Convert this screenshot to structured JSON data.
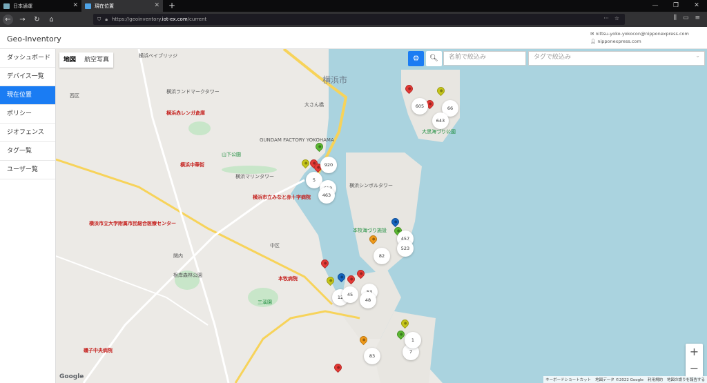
{
  "browser": {
    "tabs": [
      {
        "label": "日本通運",
        "active": false
      },
      {
        "label": "現在位置",
        "active": true
      }
    ],
    "url_prefix": "https://geoinventory.",
    "url_host": "iot-ex.com",
    "url_path": "/current"
  },
  "app": {
    "brand": "Geo-Inventory",
    "user_email": "nittsu-yoko-yokocon@nipponexpress.com",
    "user_org": "nipponexpress.com"
  },
  "sidebar": {
    "items": [
      {
        "label": "ダッシュボード",
        "active": false
      },
      {
        "label": "デバイス一覧",
        "active": false
      },
      {
        "label": "現在位置",
        "active": true
      },
      {
        "label": "ポリシー",
        "active": false
      },
      {
        "label": "ジオフェンス",
        "active": false
      },
      {
        "label": "タグ一覧",
        "active": false
      },
      {
        "label": "ユーザー覧",
        "active": false
      }
    ]
  },
  "map": {
    "maptype": [
      "地図",
      "航空写真"
    ],
    "name_filter_placeholder": "名前で絞込み",
    "tag_filter_placeholder": "タグで絞込み",
    "labels": {
      "yokohama": "横浜市",
      "kannai": "関内",
      "yamashita": "山下公園",
      "osanbashi": "大さん橋",
      "chinatown": "横浜中華街",
      "marine_tower": "横浜マリンタワー",
      "redbrick": "横浜赤レンガ倉庫",
      "landmark": "横浜ランドマークタワー",
      "gundam": "GUNDAM FACTORY YOKOHAMA",
      "honmoku_park": "本牧海づり施設",
      "ohguro": "大黒海づり公園",
      "city_hosp": "横浜市立みなと赤十字病院",
      "univ_hosp": "横浜市立大学附属市民総合医療センター",
      "naka": "中区",
      "honmoku_hosp": "本牧病院",
      "sankei": "三溪園",
      "negishi": "根岸森林公園",
      "isogo": "磯子中央病院",
      "nishi": "西区",
      "bay_bridge": "横浜ベイブリッジ",
      "shell_tower": "横浜シンボルタワー"
    },
    "clusters": [
      "605",
      "66",
      "643",
      "920",
      "5",
      "613",
      "463",
      "457",
      "523",
      "82",
      "12",
      "45",
      "53",
      "48",
      "7",
      "83",
      "1"
    ],
    "zoom_in": "+",
    "zoom_out": "−",
    "google": "Google",
    "attribution": [
      "キーボードショートカット",
      "地図データ ©2022 Google",
      "利用規約",
      "地図の誤りを報告する"
    ]
  },
  "colors": {
    "accent": "#1a7cf3",
    "water": "#aad3df",
    "pin_red": "#e53935",
    "pin_yellow": "#c6c61a",
    "pin_green": "#5cb832",
    "pin_blue": "#1565c0",
    "pin_orange": "#f09a1a"
  }
}
